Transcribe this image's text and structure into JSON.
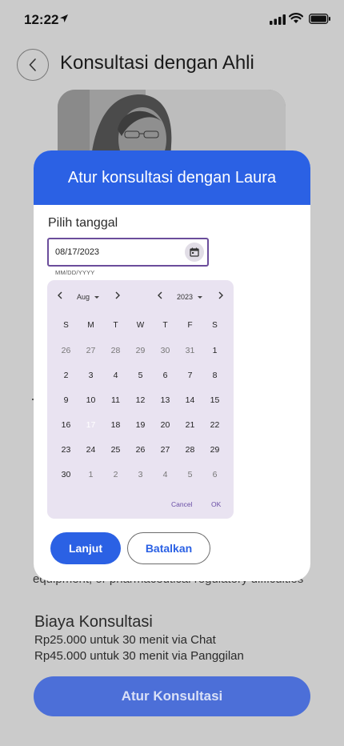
{
  "status_bar": {
    "time": "12:22"
  },
  "header": {
    "title": "Konsultasi dengan Ahli"
  },
  "background": {
    "description": "equipment, or pharmaceutical regulatory difficulties",
    "fee_title": "Biaya Konsultasi",
    "fee_chat": "Rp25.000 untuk 30 menit via Chat",
    "fee_call": "Rp45.000 untuk 30 menit via Panggilan",
    "cta_label": "Atur Konsultasi"
  },
  "modal": {
    "title": "Atur konsultasi dengan Laura",
    "date_label": "Pilih tanggal",
    "date_value": "08/17/2023",
    "date_hint": "MM/DD/YYYY",
    "primary_label": "Lanjut",
    "secondary_label": "Batalkan"
  },
  "calendar": {
    "month": "Aug",
    "year": "2023",
    "weekdays": [
      "S",
      "M",
      "T",
      "W",
      "T",
      "F",
      "S"
    ],
    "weeks": [
      [
        "26",
        "27",
        "28",
        "29",
        "30",
        "31",
        "1"
      ],
      [
        "2",
        "3",
        "4",
        "5",
        "6",
        "7",
        "8"
      ],
      [
        "9",
        "10",
        "11",
        "12",
        "13",
        "14",
        "15"
      ],
      [
        "16",
        "17",
        "18",
        "19",
        "20",
        "21",
        "22"
      ],
      [
        "23",
        "24",
        "25",
        "26",
        "27",
        "28",
        "29"
      ],
      [
        "30",
        "1",
        "2",
        "3",
        "4",
        "5",
        "6"
      ]
    ],
    "selected_day": "17",
    "cancel_label": "Cancel",
    "ok_label": "OK"
  }
}
